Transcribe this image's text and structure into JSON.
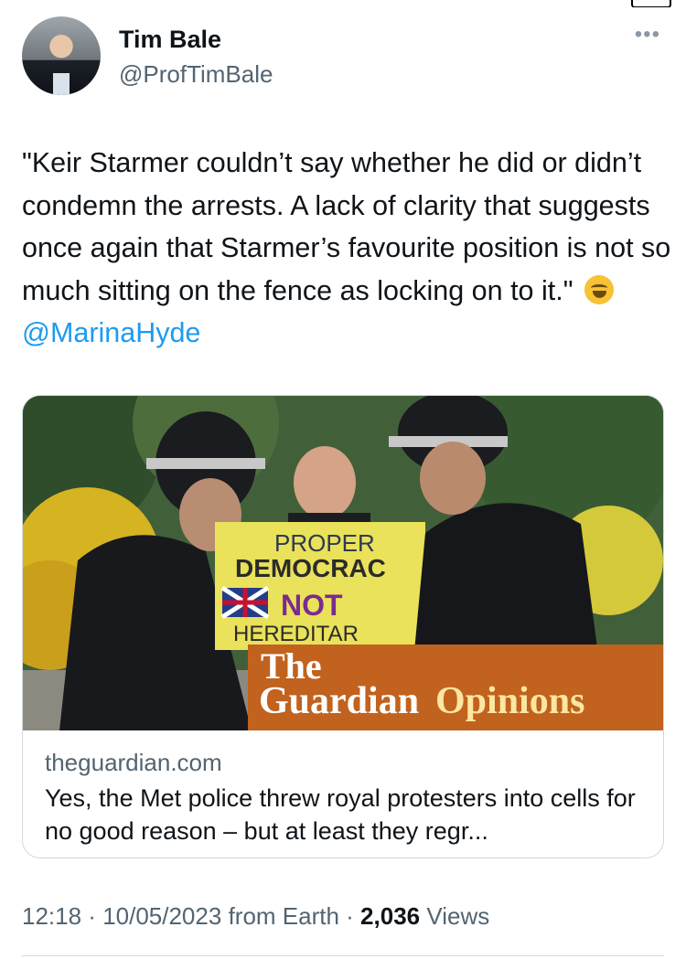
{
  "author": {
    "name": "Tim Bale",
    "handle": "@ProfTimBale"
  },
  "more_icon": "more-horizontal-icon",
  "tweet": {
    "text": "\"Keir Starmer couldn’t say whether he did or didn’t condemn the arrests. A lack of clarity that suggests once again that Starmer’s favourite position is not so much sitting on the fence as locking on to it.\"",
    "emoji": "rolling-on-floor-laughing-emoji",
    "mention": "@MarinaHyde"
  },
  "link_card": {
    "image_sign": {
      "line1": "PROPER",
      "line2": "DEMOCRAC",
      "line3": "NOT",
      "line4": "HEREDITAR"
    },
    "brand_the": "The",
    "brand_guardian": "Guardian",
    "brand_opinions": "Opinions",
    "domain": "theguardian.com",
    "title": "Yes, the Met police threw royal protesters into cells for no good reason – but at least they regr..."
  },
  "meta": {
    "time": "12:18",
    "date": "10/05/2023",
    "source": "from Earth",
    "views_count": "2,036",
    "views_label": "Views"
  },
  "colors": {
    "accent": "#1d9bf0",
    "guardian_orange": "#c1621e"
  }
}
